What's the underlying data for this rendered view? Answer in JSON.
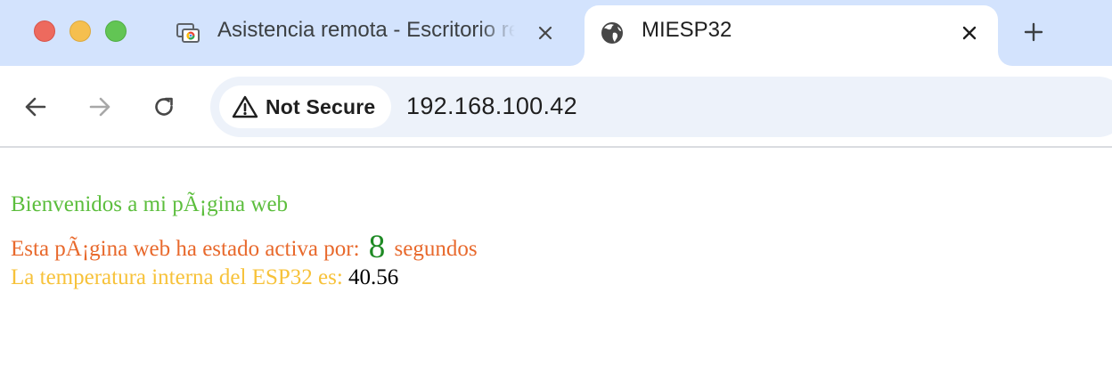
{
  "browser": {
    "tabs": [
      {
        "title": "Asistencia remota - Escritorio remoto de Chrome",
        "icon": "remote-desktop-icon",
        "active": false
      },
      {
        "title": "MIESP32",
        "icon": "globe-icon",
        "active": true
      }
    ],
    "security_label": "Not Secure",
    "url": "192.168.100.42"
  },
  "page": {
    "welcome": "Bienvenidos a mi pÃ¡gina web",
    "uptime_prefix": "Esta pÃ¡gina web ha estado activa por:",
    "uptime_value": "8",
    "uptime_suffix": "segundos",
    "temp_prefix": "La temperatura interna del ESP32 es:",
    "temp_value": "40.56"
  },
  "colors": {
    "tabstrip": "#d3e3fd",
    "welcome": "#5cbe3d",
    "uptime_text": "#e8692c",
    "uptime_value": "#1e8a24",
    "temp_text": "#f7c23a"
  }
}
